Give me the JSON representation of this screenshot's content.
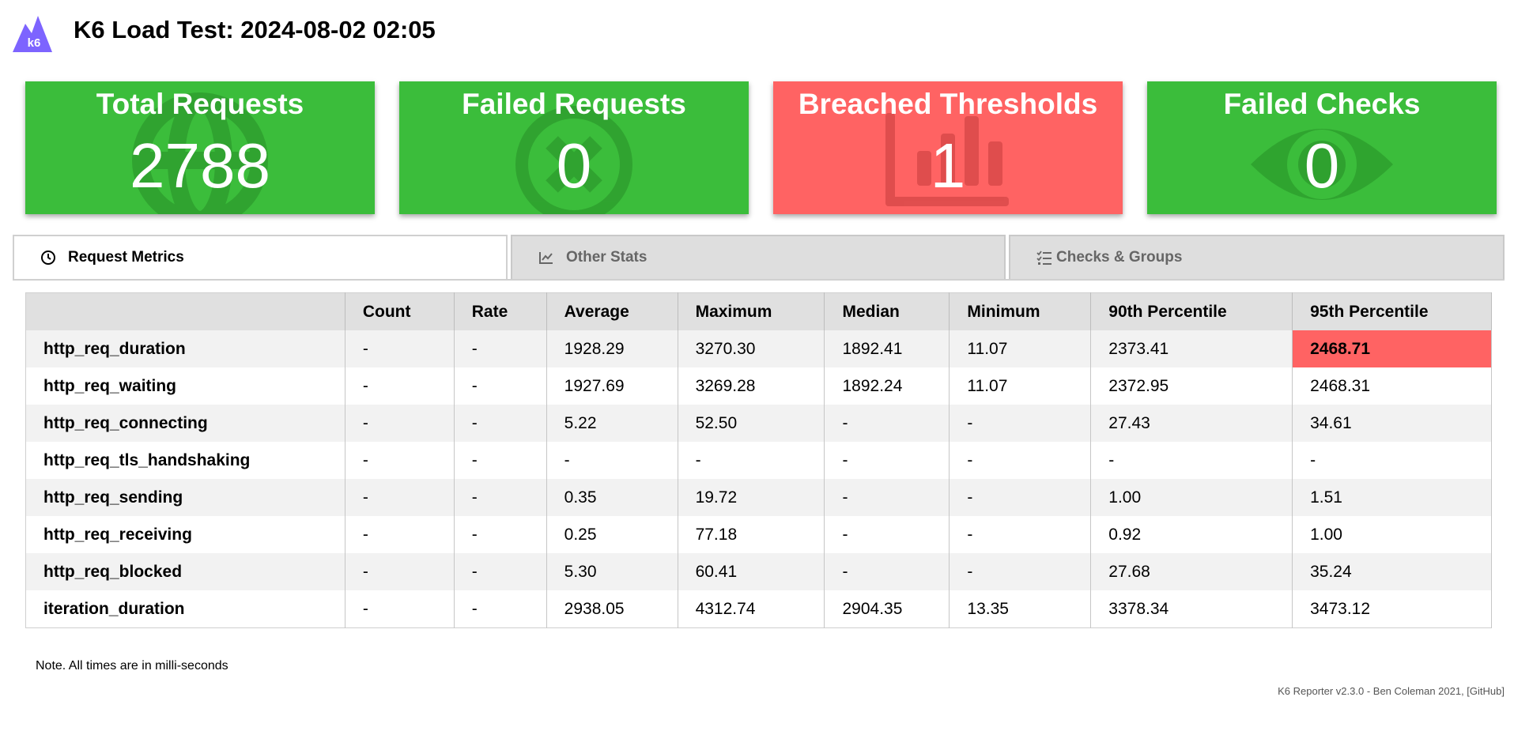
{
  "header": {
    "title": "K6 Load Test: 2024-08-02 02:05",
    "logo_text": "k6"
  },
  "cards": [
    {
      "label": "Total Requests",
      "value": "2788",
      "status": "good",
      "icon": "globe-icon"
    },
    {
      "label": "Failed Requests",
      "value": "0",
      "status": "good",
      "icon": "x-circle-icon"
    },
    {
      "label": "Breached Thresholds",
      "value": "1",
      "status": "bad",
      "icon": "bar-chart-icon"
    },
    {
      "label": "Failed Checks",
      "value": "0",
      "status": "good",
      "icon": "eye-icon"
    }
  ],
  "tabs": [
    {
      "label": "Request Metrics",
      "icon": "clock-icon",
      "active": true
    },
    {
      "label": "Other Stats",
      "icon": "line-chart-icon",
      "active": false
    },
    {
      "label": "Checks & Groups",
      "icon": "checklist-icon",
      "active": false
    }
  ],
  "table": {
    "headers": [
      "",
      "Count",
      "Rate",
      "Average",
      "Maximum",
      "Median",
      "Minimum",
      "90th Percentile",
      "95th Percentile"
    ],
    "rows": [
      [
        "http_req_duration",
        "-",
        "-",
        "1928.29",
        "3270.30",
        "1892.41",
        "11.07",
        "2373.41",
        "2468.71"
      ],
      [
        "http_req_waiting",
        "-",
        "-",
        "1927.69",
        "3269.28",
        "1892.24",
        "11.07",
        "2372.95",
        "2468.31"
      ],
      [
        "http_req_connecting",
        "-",
        "-",
        "5.22",
        "52.50",
        "-",
        "-",
        "27.43",
        "34.61"
      ],
      [
        "http_req_tls_handshaking",
        "-",
        "-",
        "-",
        "-",
        "-",
        "-",
        "-",
        "-"
      ],
      [
        "http_req_sending",
        "-",
        "-",
        "0.35",
        "19.72",
        "-",
        "-",
        "1.00",
        "1.51"
      ],
      [
        "http_req_receiving",
        "-",
        "-",
        "0.25",
        "77.18",
        "-",
        "-",
        "0.92",
        "1.00"
      ],
      [
        "http_req_blocked",
        "-",
        "-",
        "5.30",
        "60.41",
        "-",
        "-",
        "27.68",
        "35.24"
      ],
      [
        "iteration_duration",
        "-",
        "-",
        "2938.05",
        "4312.74",
        "2904.35",
        "13.35",
        "3378.34",
        "3473.12"
      ]
    ],
    "failed_cells": [
      [
        0,
        8
      ]
    ]
  },
  "note": "Note. All times are in milli-seconds",
  "footer": "K6 Reporter v2.3.0 - Ben Coleman 2021, [GitHub]",
  "colors": {
    "good": "#3bbd3b",
    "bad": "#ff6363",
    "brand": "#7d64ff"
  }
}
